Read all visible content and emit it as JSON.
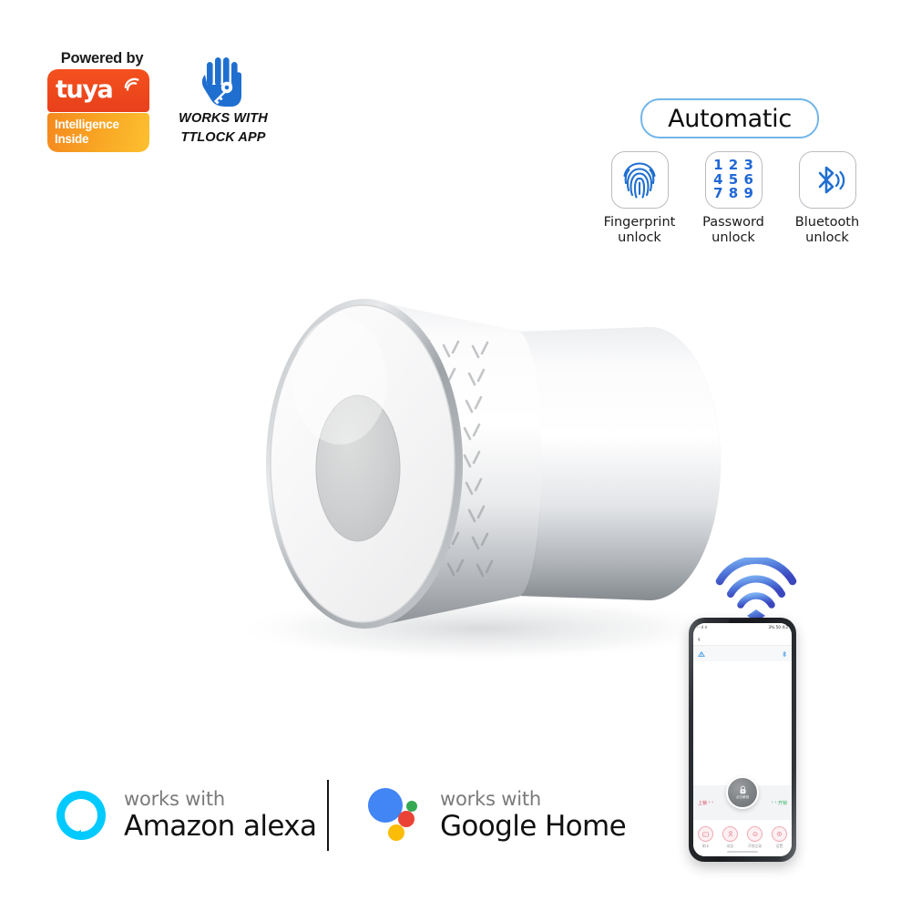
{
  "page": {
    "background_color": "#ffffff",
    "product_name": "smart-lock-cylinder-knob"
  },
  "tuya_badge": {
    "powered_by": "Powered by",
    "wordmark": "tuya",
    "tagline_line1": "Intelligence",
    "tagline_line2": "Inside",
    "top_color": "#ef4623",
    "bottom_color_start": "#f4891f",
    "bottom_color_end": "#fdc02f",
    "wifi_icon": "wifi-arc-icon"
  },
  "ttlock_badge": {
    "icon": "hand-with-key-icon",
    "icon_color": "#1f6fd0",
    "line1": "WORKS WITH",
    "line2": "TTLOCK APP"
  },
  "automatic_pill": {
    "label": "Automatic",
    "border_color": "#72b6e8",
    "text_color": "#0d0d0d"
  },
  "unlock_features": [
    {
      "icon": "fingerprint-icon",
      "icon_color": "#1f6fd0",
      "label_line1": "Fingerprint",
      "label_line2": "unlock"
    },
    {
      "icon": "keypad-icon",
      "icon_color": "#2067d6",
      "digits": [
        "1",
        "2",
        "3",
        "4",
        "5",
        "6",
        "7",
        "8",
        "9"
      ],
      "label_line1": "Password",
      "label_line2": "unlock"
    },
    {
      "icon": "bluetooth-icon",
      "icon_color": "#1f6fd0",
      "label_line1": "Bluetooth",
      "label_line2": "unlock"
    }
  ],
  "product": {
    "name": "cylindrical-smart-lock-knob",
    "body_color_light": "#fdfdfd",
    "body_color_mid": "#d9dbdd",
    "body_color_dark": "#9ea2a6",
    "face_color": "#f4f4f4",
    "face_inner_circle_color": "#cfd0d1",
    "shadow_color": "#e3e4e6"
  },
  "wifi_icon": {
    "name": "wifi-signal-icon",
    "color_start": "#6aa9f0",
    "color_end": "#3f51c4",
    "arc_count": 3
  },
  "phone": {
    "name": "smartphone-mockup",
    "frame_color": "#24272a",
    "screen_background": "#ffffff",
    "status_left": "··· ıl ıl",
    "status_right": "3% 50 4:2",
    "back_icon": "back-chevron-icon",
    "subbar_left_icon": "signal-icon",
    "subbar_right_icon": "bluetooth-small-icon",
    "lock_panel": {
      "left_label": "上锁",
      "left_chevrons": "‹ ‹",
      "right_chevrons": "› ›",
      "right_label": "开锁",
      "knob_icon": "padlock-icon",
      "knob_label": "点击解锁"
    },
    "actions": [
      {
        "icon": "card-icon",
        "label": "刷卡"
      },
      {
        "icon": "person-icon",
        "label": "成员"
      },
      {
        "icon": "bell-icon",
        "label": "开锁记录"
      },
      {
        "icon": "gear-icon",
        "label": "设置"
      }
    ]
  },
  "partners": [
    {
      "id": "amazon-alexa",
      "icon": "alexa-ring-icon",
      "icon_color": "#00caff",
      "small_text": "works with",
      "big_text": "Amazon alexa"
    },
    {
      "id": "google-home",
      "icon": "google-assistant-dots-icon",
      "colors": [
        "#4285f4",
        "#34a853",
        "#ea4335",
        "#fbbc05"
      ],
      "small_text": "works with",
      "big_text": "Google Home"
    }
  ]
}
